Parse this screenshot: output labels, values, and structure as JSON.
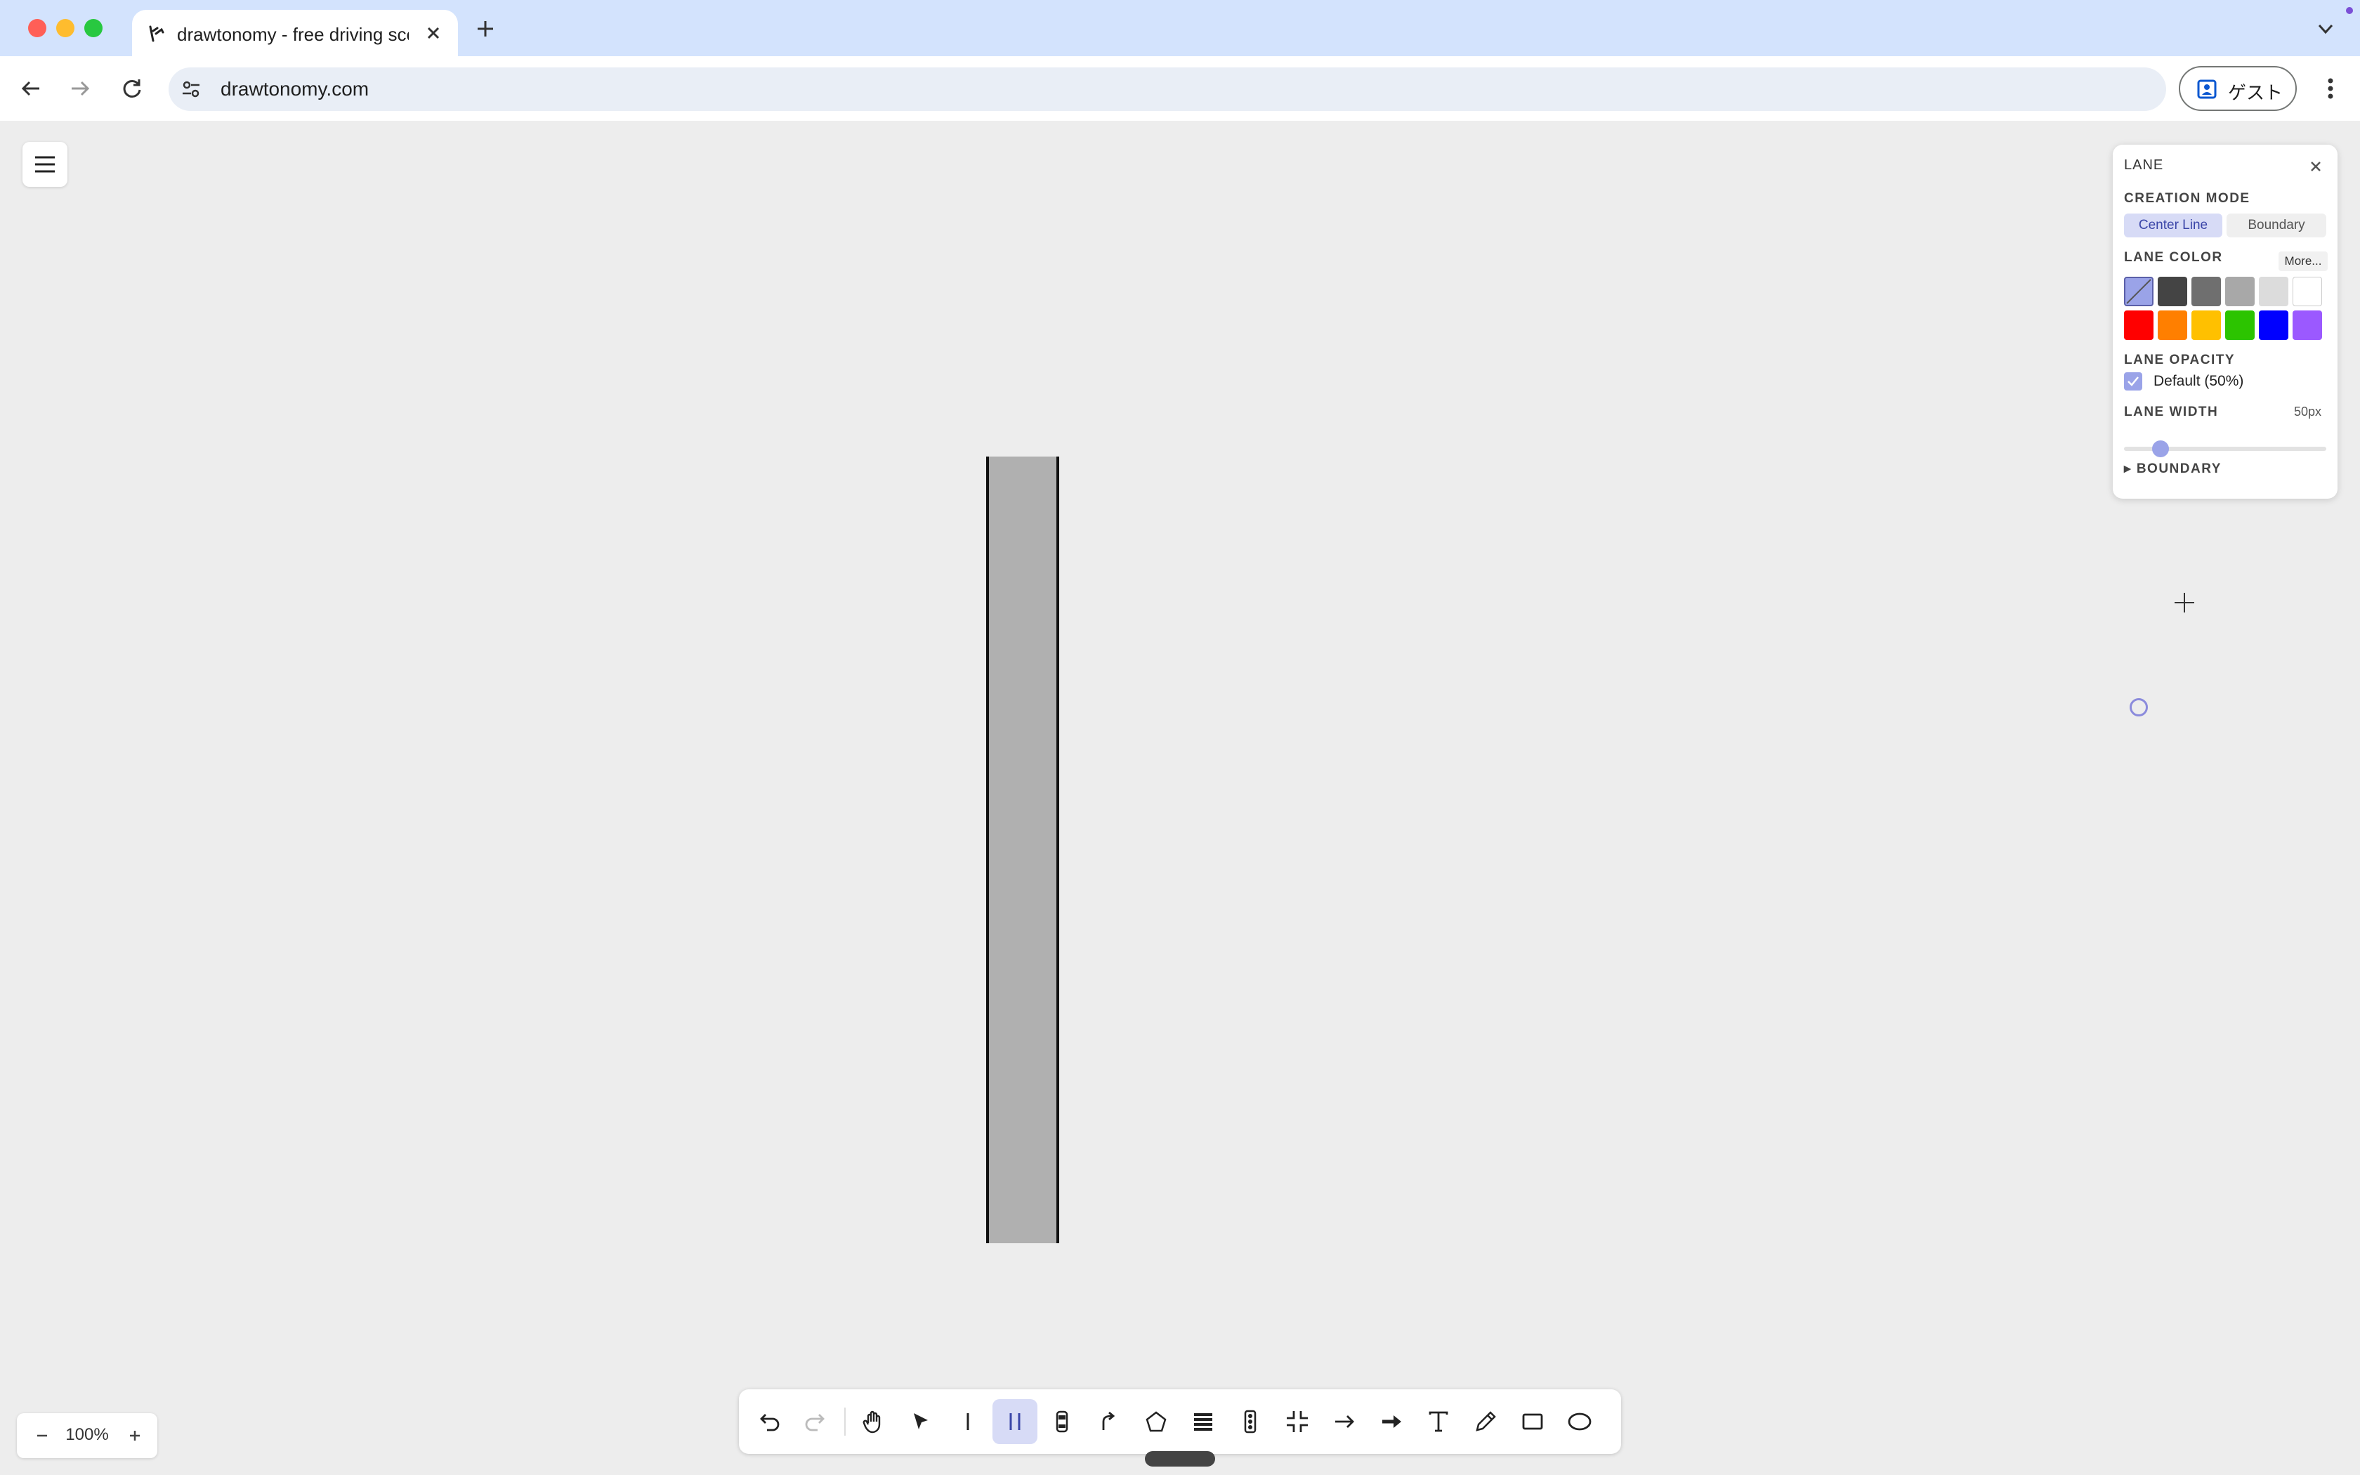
{
  "browser": {
    "tab_title": "drawtonomy - free driving scene",
    "url": "drawtonomy.com",
    "guest_label": "ゲスト"
  },
  "lane_panel": {
    "title": "LANE",
    "creation_mode_label": "CREATION MODE",
    "modes": [
      "Center Line",
      "Boundary"
    ],
    "active_mode": "Center Line",
    "lane_color_label": "LANE COLOR",
    "more_label": "More...",
    "colors_row1": [
      "#9aa3e8",
      "#444444",
      "#6f6f6f",
      "#a8a8a8",
      "#dcdcdc",
      "#ffffff"
    ],
    "colors_row2": [
      "#ff0000",
      "#ff7f00",
      "#ffc000",
      "#2cc400",
      "#0000ff",
      "#9b59ff"
    ],
    "lane_opacity_label": "LANE OPACITY",
    "opacity_checkbox_label": "Default (50%)",
    "opacity_checked": true,
    "lane_width_label": "LANE WIDTH",
    "lane_width_value": "50px",
    "boundary_label": "▸ BOUNDARY"
  },
  "zoom": {
    "minus": "−",
    "value": "100%",
    "plus": "+"
  }
}
